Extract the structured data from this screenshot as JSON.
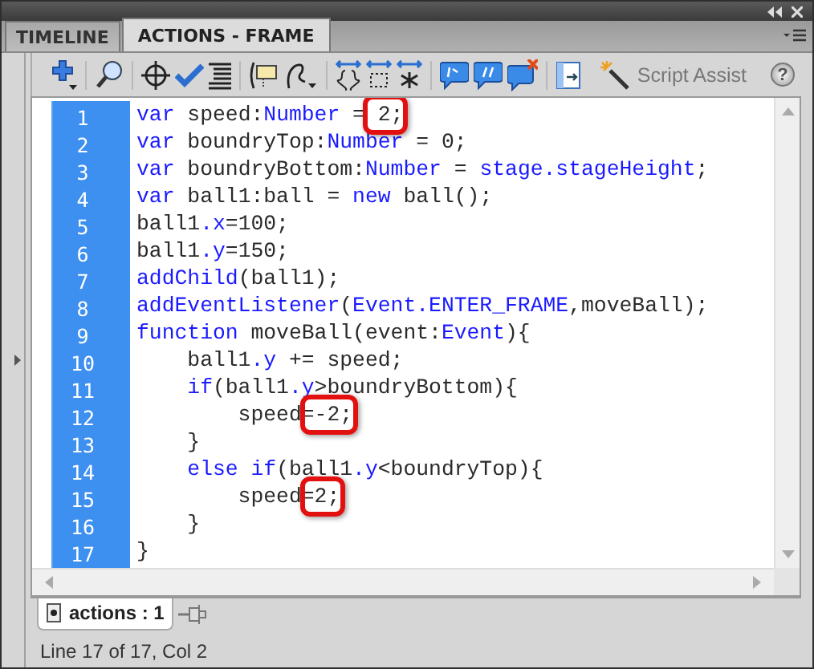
{
  "panel_tabs": [
    {
      "label": "TIMELINE",
      "selected": false
    },
    {
      "label": "ACTIONS - FRAME",
      "selected": true
    }
  ],
  "toolbar": {
    "script_assist": "Script Assist",
    "help": "?"
  },
  "code_lines": [
    {
      "number": "1",
      "selected": true,
      "tokens": [
        {
          "kind": "keyword",
          "text": "var"
        },
        {
          "kind": "plain",
          "text": " speed:"
        },
        {
          "kind": "keyword",
          "text": "Number"
        },
        {
          "kind": "plain",
          "text": " ="
        },
        {
          "kind": "boxed",
          "text": " 2;"
        }
      ]
    },
    {
      "number": "2",
      "selected": true,
      "tokens": [
        {
          "kind": "keyword",
          "text": "var"
        },
        {
          "kind": "plain",
          "text": " boundryTop:"
        },
        {
          "kind": "keyword",
          "text": "Number"
        },
        {
          "kind": "plain",
          "text": " = 0;"
        }
      ]
    },
    {
      "number": "3",
      "selected": true,
      "tokens": [
        {
          "kind": "keyword",
          "text": "var"
        },
        {
          "kind": "plain",
          "text": " boundryBottom:"
        },
        {
          "kind": "keyword",
          "text": "Number"
        },
        {
          "kind": "plain",
          "text": " = "
        },
        {
          "kind": "keyword",
          "text": "stage.stageHeight"
        },
        {
          "kind": "plain",
          "text": ";"
        }
      ]
    },
    {
      "number": "4",
      "selected": true,
      "tokens": [
        {
          "kind": "keyword",
          "text": "var"
        },
        {
          "kind": "plain",
          "text": " ball1:ball = "
        },
        {
          "kind": "keyword",
          "text": "new"
        },
        {
          "kind": "plain",
          "text": " ball();"
        }
      ]
    },
    {
      "number": "5",
      "selected": true,
      "tokens": [
        {
          "kind": "plain",
          "text": "ball1"
        },
        {
          "kind": "keyword",
          "text": ".x"
        },
        {
          "kind": "plain",
          "text": "=100;"
        }
      ]
    },
    {
      "number": "6",
      "selected": true,
      "tokens": [
        {
          "kind": "plain",
          "text": "ball1"
        },
        {
          "kind": "keyword",
          "text": ".y"
        },
        {
          "kind": "plain",
          "text": "=150;"
        }
      ]
    },
    {
      "number": "7",
      "selected": true,
      "tokens": [
        {
          "kind": "keyword",
          "text": "addChild"
        },
        {
          "kind": "plain",
          "text": "(ball1);"
        }
      ]
    },
    {
      "number": "8",
      "selected": true,
      "tokens": [
        {
          "kind": "keyword",
          "text": "addEventListener"
        },
        {
          "kind": "plain",
          "text": "("
        },
        {
          "kind": "keyword",
          "text": "Event.ENTER_FRAME"
        },
        {
          "kind": "plain",
          "text": ",moveBall);"
        }
      ]
    },
    {
      "number": "9",
      "selected": true,
      "tokens": [
        {
          "kind": "keyword",
          "text": "function"
        },
        {
          "kind": "plain",
          "text": " moveBall(event:"
        },
        {
          "kind": "keyword",
          "text": "Event"
        },
        {
          "kind": "plain",
          "text": "){"
        }
      ]
    },
    {
      "number": "10",
      "selected": true,
      "tokens": [
        {
          "kind": "plain",
          "text": "    ball1"
        },
        {
          "kind": "keyword",
          "text": ".y"
        },
        {
          "kind": "plain",
          "text": " += speed;"
        }
      ]
    },
    {
      "number": "11",
      "selected": true,
      "tokens": [
        {
          "kind": "keyword",
          "text": "    if"
        },
        {
          "kind": "plain",
          "text": "(ball1"
        },
        {
          "kind": "keyword",
          "text": ".y"
        },
        {
          "kind": "plain",
          "text": ">boundryBottom){"
        }
      ]
    },
    {
      "number": "12",
      "selected": true,
      "tokens": [
        {
          "kind": "plain",
          "text": "        speed"
        },
        {
          "kind": "boxed",
          "text": "=-2;"
        }
      ]
    },
    {
      "number": "13",
      "selected": true,
      "tokens": [
        {
          "kind": "plain",
          "text": "    }"
        }
      ]
    },
    {
      "number": "14",
      "selected": true,
      "tokens": [
        {
          "kind": "keyword",
          "text": "    else if"
        },
        {
          "kind": "plain",
          "text": "(ball1"
        },
        {
          "kind": "keyword",
          "text": ".y"
        },
        {
          "kind": "plain",
          "text": "<boundryTop){"
        }
      ]
    },
    {
      "number": "15",
      "selected": true,
      "tokens": [
        {
          "kind": "plain",
          "text": "        speed"
        },
        {
          "kind": "boxed",
          "text": "=2;"
        }
      ]
    },
    {
      "number": "16",
      "selected": true,
      "tokens": [
        {
          "kind": "plain",
          "text": "    }"
        }
      ]
    },
    {
      "number": "17",
      "selected": true,
      "tokens": [
        {
          "kind": "plain",
          "text": "}"
        }
      ]
    }
  ],
  "script_tabs": [
    {
      "label": "actions : 1",
      "selected": true
    }
  ],
  "status_bar": "Line 17 of 17, Col 2"
}
